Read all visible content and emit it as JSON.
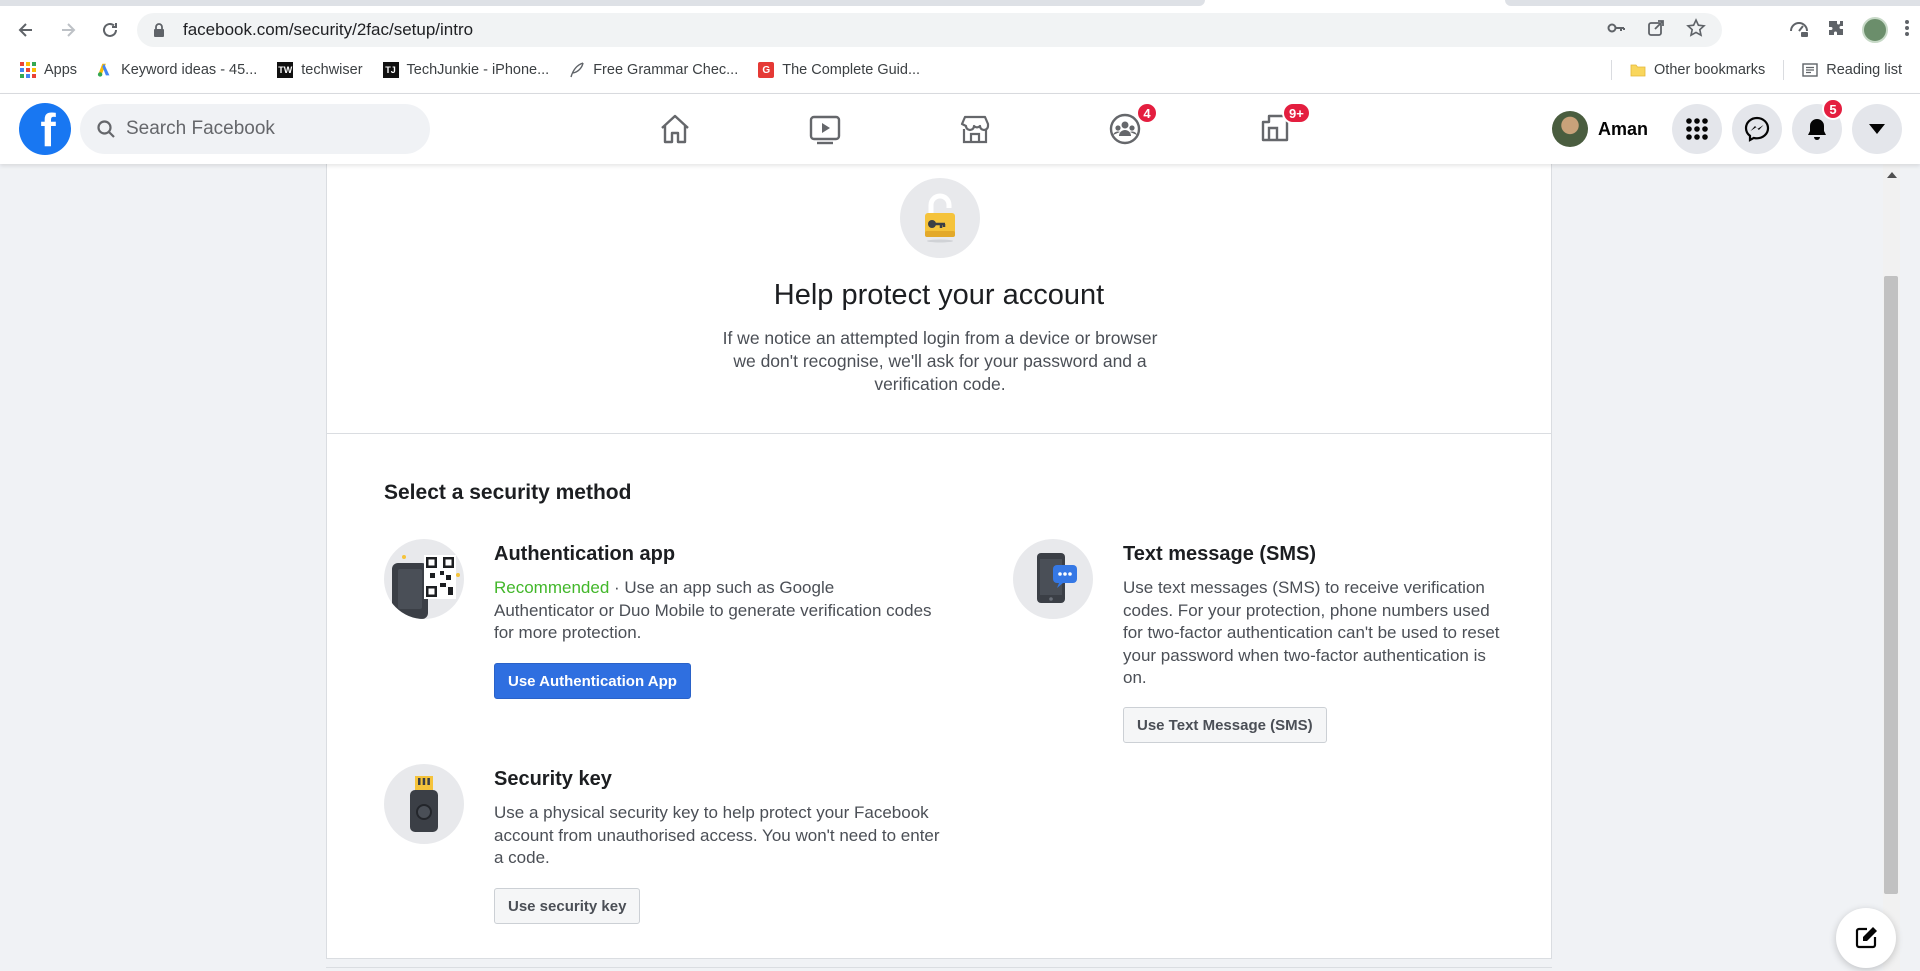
{
  "browser": {
    "url": "facebook.com/security/2fac/setup/intro",
    "bookmarks": [
      {
        "label": "Apps",
        "icon": "apps-grid-icon"
      },
      {
        "label": "Keyword ideas - 45...",
        "icon": "google-ads-icon"
      },
      {
        "label": "techwiser",
        "icon": "techwiser-icon"
      },
      {
        "label": "TechJunkie - iPhone...",
        "icon": "techjunkie-icon"
      },
      {
        "label": "Free Grammar Chec...",
        "icon": "quill-icon"
      },
      {
        "label": "The Complete Guid...",
        "icon": "g-logo-icon"
      }
    ],
    "other_bookmarks": "Other bookmarks",
    "reading_list": "Reading list"
  },
  "fb_header": {
    "search_placeholder": "Search Facebook",
    "nav_badges": {
      "groups": "4",
      "gaming": "9+"
    },
    "profile_name": "Aman",
    "notifications_badge": "5"
  },
  "intro": {
    "title": "Help protect your account",
    "description": "If we notice an attempted login from a device or browser we don't recognise, we'll ask for your password and a verification code."
  },
  "methods_section": {
    "title": "Select a security method",
    "auth_app": {
      "title": "Authentication app",
      "recommended": "Recommended",
      "description": " · Use an app such as Google Authenticator or Duo Mobile to generate verification codes for more protection.",
      "button": "Use Authentication App"
    },
    "sms": {
      "title": "Text message (SMS)",
      "description": "Use text messages (SMS) to receive verification codes. For your protection, phone numbers used for two-factor authentication can't be used to reset your password when two-factor authentication is on.",
      "button": "Use Text Message (SMS)"
    },
    "security_key": {
      "title": "Security key",
      "description": "Use a physical security key to help protect your Facebook account from unauthorised access. You won't need to enter a code.",
      "button": "Use security key"
    }
  },
  "colors": {
    "facebook_blue": "#1877f2",
    "primary_button": "#2f6fe0",
    "recommended_green": "#42b72a",
    "badge_red": "#e41e3f"
  }
}
